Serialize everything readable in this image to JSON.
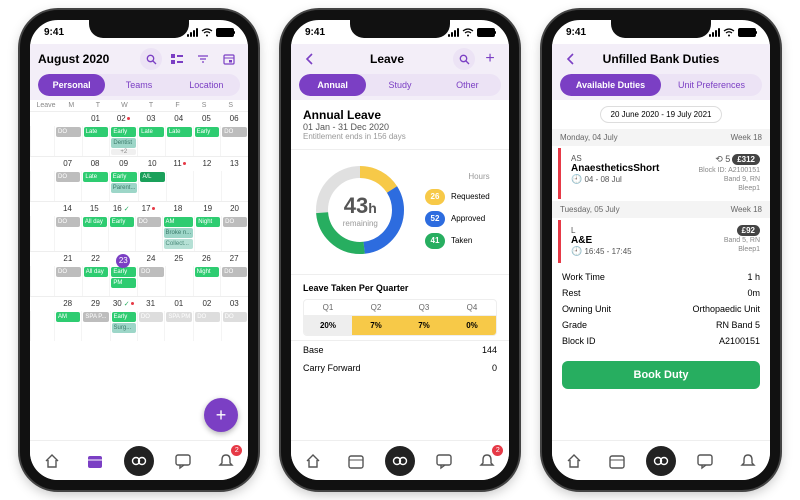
{
  "status_time": "9:41",
  "notif_badge": "2",
  "tabbar": [
    "home-icon",
    "calendar-icon",
    "loop-icon",
    "chat-icon",
    "bell-icon"
  ],
  "phone1": {
    "title": "August 2020",
    "tabs": [
      "Personal",
      "Teams",
      "Location"
    ],
    "leave_label": "Leave",
    "dow": [
      "M",
      "T",
      "W",
      "T",
      "F",
      "S",
      "S"
    ],
    "weeks": [
      {
        "nums": [
          "",
          "01",
          "02",
          "03",
          "04",
          "05",
          "06"
        ],
        "dots": [
          null,
          null,
          "#e63946",
          null,
          null,
          null,
          null
        ],
        "cells": [
          [
            {
              "t": "DO",
              "c": "gray"
            }
          ],
          [
            {
              "t": "Late",
              "c": "green"
            }
          ],
          [
            {
              "t": "Early",
              "c": "green"
            },
            {
              "t": "Dentist",
              "c": "teal"
            },
            {
              "t": "+2",
              "c": "more"
            }
          ],
          [
            {
              "t": "Late",
              "c": "green"
            }
          ],
          [
            {
              "t": "Late",
              "c": "green"
            }
          ],
          [
            {
              "t": "Early",
              "c": "green"
            }
          ],
          [
            {
              "t": "DO",
              "c": "gray"
            }
          ]
        ]
      },
      {
        "nums": [
          "07",
          "08",
          "09",
          "10",
          "11",
          "12",
          "13"
        ],
        "dots": [
          null,
          null,
          null,
          null,
          "#e63946",
          null,
          null
        ],
        "cells": [
          [
            {
              "t": "DO",
              "c": "gray"
            }
          ],
          [
            {
              "t": "Late",
              "c": "green"
            }
          ],
          [
            {
              "t": "Early",
              "c": "green"
            },
            {
              "t": "Parent...",
              "c": "teal"
            }
          ],
          [
            {
              "t": "A/L",
              "c": "dgreen"
            }
          ],
          [],
          [],
          []
        ]
      },
      {
        "nums": [
          "14",
          "15",
          "16",
          "17",
          "18",
          "19",
          "20"
        ],
        "dots": [
          null,
          null,
          "ok",
          "#e63946",
          null,
          null,
          null
        ],
        "cells": [
          [
            {
              "t": "DO",
              "c": "gray"
            }
          ],
          [
            {
              "t": "All day",
              "c": "green"
            }
          ],
          [
            {
              "t": "Early",
              "c": "green"
            }
          ],
          [
            {
              "t": "DO",
              "c": "gray"
            }
          ],
          [
            {
              "t": "AM",
              "c": "green"
            },
            {
              "t": "Broke n...",
              "c": "teal"
            },
            {
              "t": "Collect...",
              "c": "lteal"
            }
          ],
          [
            {
              "t": "Night",
              "c": "green"
            }
          ],
          [
            {
              "t": "DO",
              "c": "gray"
            }
          ]
        ]
      },
      {
        "nums": [
          "21",
          "22",
          "23",
          "24",
          "25",
          "26",
          "27"
        ],
        "dots": [
          null,
          null,
          "circled",
          null,
          null,
          null,
          null
        ],
        "cells": [
          [
            {
              "t": "DO",
              "c": "gray"
            }
          ],
          [
            {
              "t": "All day",
              "c": "green"
            }
          ],
          [
            {
              "t": "Early",
              "c": "green"
            },
            {
              "t": "PM",
              "c": "green"
            }
          ],
          [
            {
              "t": "DO",
              "c": "gray"
            }
          ],
          [],
          [
            {
              "t": "Night",
              "c": "green"
            }
          ],
          [
            {
              "t": "DO",
              "c": "gray"
            }
          ]
        ]
      },
      {
        "nums": [
          "28",
          "29",
          "30",
          "31",
          "01",
          "02",
          "03"
        ],
        "dots": [
          null,
          null,
          "okred",
          null,
          null,
          null,
          null
        ],
        "cells": [
          [
            {
              "t": "AM",
              "c": "green"
            }
          ],
          [
            {
              "t": "SPA P...",
              "c": "gray"
            }
          ],
          [
            {
              "t": "Early",
              "c": "green"
            },
            {
              "t": "Surg...",
              "c": "teal"
            }
          ],
          [
            {
              "t": "DO",
              "c": "gray faded"
            }
          ],
          [
            {
              "t": "SPA PM",
              "c": "gray faded"
            }
          ],
          [
            {
              "t": "DO",
              "c": "gray faded"
            }
          ],
          [
            {
              "t": "DO",
              "c": "gray faded"
            }
          ]
        ]
      }
    ]
  },
  "phone2": {
    "title": "Leave",
    "tabs": [
      "Annual",
      "Study",
      "Other"
    ],
    "leave_title": "Annual Leave",
    "leave_range": "01 Jan - 31 Dec 2020",
    "leave_ent": "Entitlement ends in 156 days",
    "remaining_value": "43",
    "remaining_unit": "h",
    "remaining_label": "remaining",
    "legend_header": "Hours",
    "legend": [
      {
        "n": "26",
        "c": "#f7c948",
        "l": "Requested"
      },
      {
        "n": "52",
        "c": "#2d6cdf",
        "l": "Approved"
      },
      {
        "n": "41",
        "c": "#27ae60",
        "l": "Taken"
      }
    ],
    "quarter_title": "Leave Taken Per Quarter",
    "quarters": [
      {
        "q": "Q1",
        "v": "20%",
        "c": "gray"
      },
      {
        "q": "Q2",
        "v": "7%",
        "c": "yellow"
      },
      {
        "q": "Q3",
        "v": "7%",
        "c": "yellow"
      },
      {
        "q": "Q4",
        "v": "0%",
        "c": "yellow"
      }
    ],
    "base_label": "Base",
    "base_val": "144",
    "carry_label": "Carry Forward",
    "carry_val": "0"
  },
  "phone3": {
    "title": "Unfilled Bank Duties",
    "tabs": [
      "Available Duties",
      "Unit Preferences"
    ],
    "range": "20 June 2020 - 19 July 2021",
    "days": [
      {
        "header": "Monday, 04 July",
        "week": "Week 18",
        "code": "AS",
        "count": "5",
        "price": "£312",
        "name": "AnaestheticsShort",
        "block": "Block ID: A2100151",
        "band": "Band 9, RN",
        "bleep": "Bleep1",
        "time": "04 - 08 Jul",
        "clock": "🕘"
      },
      {
        "header": "Tuesday, 05 July",
        "week": "Week 18",
        "code": "L",
        "count": "",
        "price": "£92",
        "name": "A&E",
        "block": "",
        "band": "Band 5, RN",
        "bleep": "Bleep1",
        "time": "16:45 - 17:45",
        "clock": "🕘"
      }
    ],
    "details": [
      {
        "k": "Work Time",
        "v": "1 h"
      },
      {
        "k": "Rest",
        "v": "0m"
      },
      {
        "k": "Owning Unit",
        "v": "Orthopaedic Unit"
      },
      {
        "k": "Grade",
        "v": "RN Band 5"
      },
      {
        "k": "Block ID",
        "v": "A2100151"
      }
    ],
    "book_label": "Book Duty"
  },
  "chart_data": {
    "type": "pie",
    "title": "Annual Leave Hours",
    "series": [
      {
        "name": "Requested",
        "value": 26,
        "color": "#f7c948"
      },
      {
        "name": "Approved",
        "value": 52,
        "color": "#2d6cdf"
      },
      {
        "name": "Taken",
        "value": 41,
        "color": "#27ae60"
      },
      {
        "name": "Remaining",
        "value": 43,
        "color": "#e0e0e0"
      }
    ],
    "center_label": "43h remaining"
  }
}
